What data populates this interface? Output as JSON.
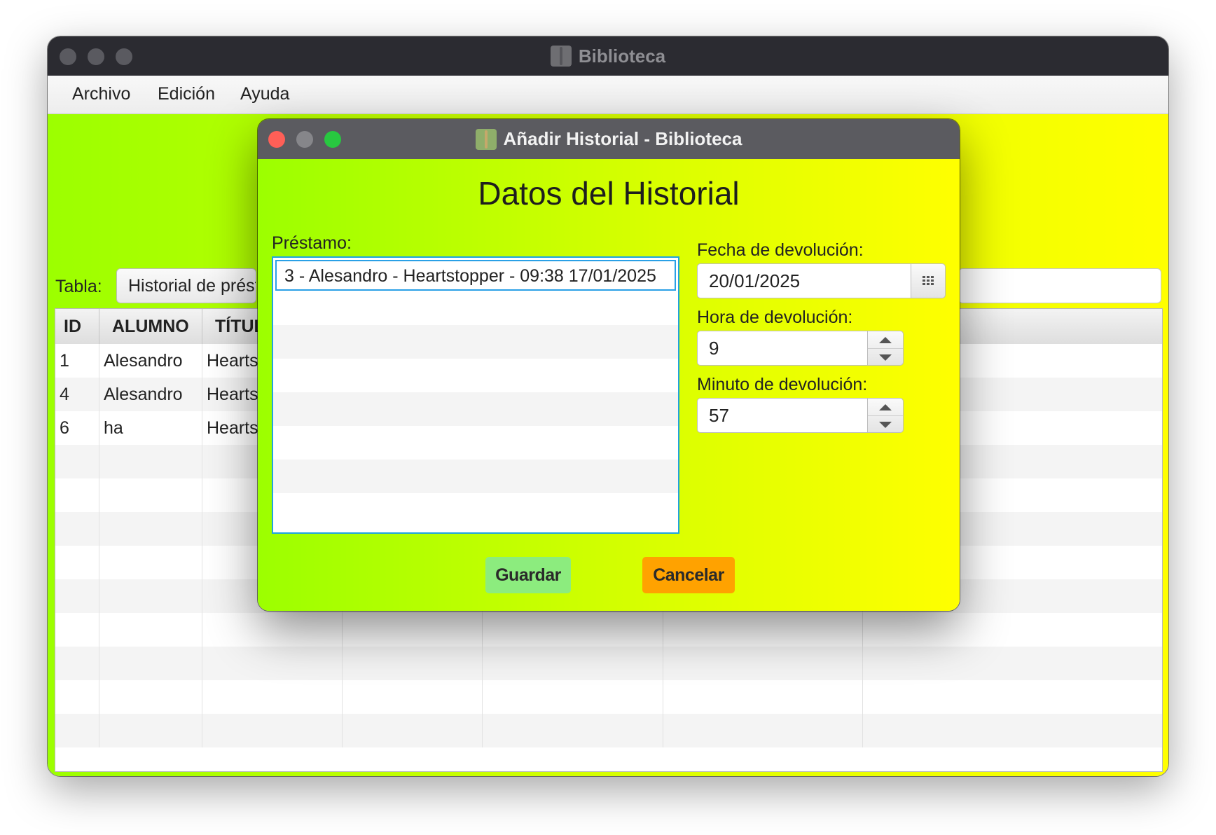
{
  "main_window": {
    "title": "Biblioteca",
    "menu": [
      "Archivo",
      "Edición",
      "Ayuda"
    ],
    "tabla_label": "Tabla:",
    "tabla_selected": "Historial de préstamos",
    "table": {
      "columns": [
        "ID",
        "ALUMNO",
        "TÍTULO"
      ],
      "rows": [
        [
          "1",
          "Alesandro",
          "Heartstopper"
        ],
        [
          "4",
          "Alesandro",
          "Heartstopper"
        ],
        [
          "6",
          "ha",
          "Heartstopper"
        ]
      ]
    }
  },
  "dialog": {
    "title": "Añadir Historial - Biblioteca",
    "heading": "Datos del Historial",
    "prestamo_label": "Préstamo:",
    "prestamo_items": [
      "3 - Alesandro - Heartstopper - 09:38 17/01/2025"
    ],
    "fecha_label": "Fecha de devolución:",
    "fecha_value": "20/01/2025",
    "hora_label": "Hora de devolución:",
    "hora_value": "9",
    "minuto_label": "Minuto de devolución:",
    "minuto_value": "57",
    "guardar_label": "Guardar",
    "cancelar_label": "Cancelar"
  },
  "icons": {
    "app": "book-icon",
    "date_picker": "calendar-icon",
    "spinner_up": "arrow-up-icon",
    "spinner_down": "arrow-down-icon"
  },
  "colors": {
    "background_gradient_start": "#9cff00",
    "background_gradient_end": "#ffff00",
    "guardar_button": "#8cec7e",
    "cancelar_button": "#ffa200",
    "selection_border": "#1fa3e0",
    "close_button": "#ff5f57",
    "zoom_button": "#28c840"
  }
}
